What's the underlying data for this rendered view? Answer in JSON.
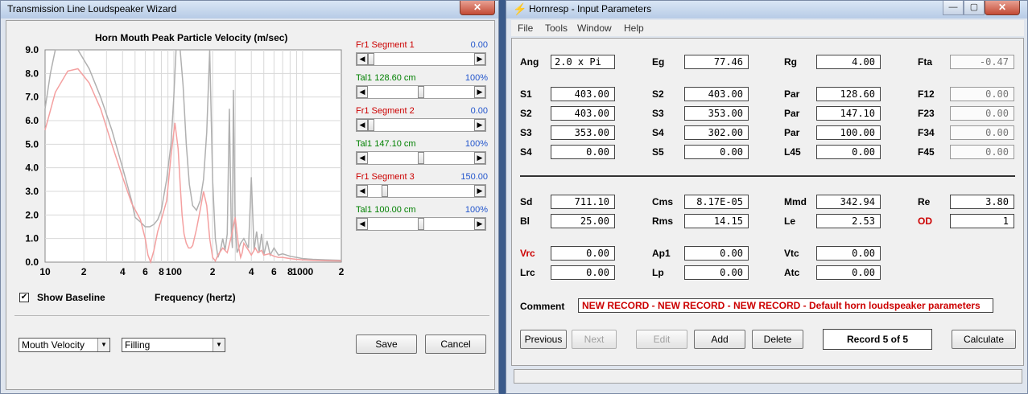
{
  "wizard": {
    "title": "Transmission Line Loudspeaker Wizard",
    "close_glyph": "✕",
    "chart_title": "Horn Mouth Peak Particle Velocity (m/sec)",
    "show_baseline_label": "Show Baseline",
    "show_baseline_checked": true,
    "check_glyph": "✔",
    "freq_label": "Frequency (hertz)",
    "dropdown_left": "Mouth Velocity",
    "dropdown_right": "Filling",
    "dd_glyph": "▼",
    "save_label": "Save",
    "cancel_label": "Cancel",
    "sliders": [
      {
        "label": "Fr1  Segment 1",
        "value": "0.00",
        "pos": 0.0,
        "color": "red"
      },
      {
        "label": "Tal1  128.60 cm",
        "value": "100%",
        "pos": 0.5,
        "color": "green"
      },
      {
        "label": "Fr1  Segment 2",
        "value": "0.00",
        "pos": 0.0,
        "color": "red"
      },
      {
        "label": "Tal1  147.10 cm",
        "value": "100%",
        "pos": 0.5,
        "color": "green"
      },
      {
        "label": "Fr1  Segment 3",
        "value": "150.00",
        "pos": 0.14,
        "color": "red"
      },
      {
        "label": "Tal1  100.00 cm",
        "value": "100%",
        "pos": 0.5,
        "color": "green"
      }
    ],
    "arrow_left": "◀",
    "arrow_right": "▶"
  },
  "hornresp": {
    "title": "Hornresp - Input Parameters",
    "minimize_glyph": "—",
    "maximize_glyph": "▢",
    "close_glyph": "✕",
    "menu": [
      "File",
      "Tools",
      "Window",
      "Help"
    ],
    "rows": [
      [
        {
          "label": "Ang",
          "value": "2.0 x Pi",
          "left": true
        },
        {
          "label": "Eg",
          "value": "77.46"
        },
        {
          "label": "Rg",
          "value": "4.00"
        },
        {
          "label": "Fta",
          "value": "-0.47",
          "ro": true
        }
      ],
      [
        {
          "label": "S1",
          "value": "403.00"
        },
        {
          "label": "S2",
          "value": "403.00"
        },
        {
          "label": "Par",
          "value": "128.60"
        },
        {
          "label": "F12",
          "value": "0.00",
          "ro": true
        }
      ],
      [
        {
          "label": "S2",
          "value": "403.00"
        },
        {
          "label": "S3",
          "value": "353.00"
        },
        {
          "label": "Par",
          "value": "147.10"
        },
        {
          "label": "F23",
          "value": "0.00",
          "ro": true
        }
      ],
      [
        {
          "label": "S3",
          "value": "353.00"
        },
        {
          "label": "S4",
          "value": "302.00"
        },
        {
          "label": "Par",
          "value": "100.00"
        },
        {
          "label": "F34",
          "value": "0.00",
          "ro": true
        }
      ],
      [
        {
          "label": "S4",
          "value": "0.00"
        },
        {
          "label": "S5",
          "value": "0.00"
        },
        {
          "label": "L45",
          "value": "0.00"
        },
        {
          "label": "F45",
          "value": "0.00",
          "ro": true
        }
      ],
      [
        {
          "label": "Sd",
          "value": "711.10"
        },
        {
          "label": "Cms",
          "value": "8.17E-05"
        },
        {
          "label": "Mmd",
          "value": "342.94"
        },
        {
          "label": "Re",
          "value": "3.80"
        }
      ],
      [
        {
          "label": "Bl",
          "value": "25.00"
        },
        {
          "label": "Rms",
          "value": "14.15"
        },
        {
          "label": "Le",
          "value": "2.53"
        },
        {
          "label": "OD",
          "value": "1",
          "red": true
        }
      ],
      [
        {
          "label": "Vrc",
          "value": "0.00",
          "red": true
        },
        {
          "label": "Ap1",
          "value": "0.00"
        },
        {
          "label": "Vtc",
          "value": "0.00"
        }
      ],
      [
        {
          "label": "Lrc",
          "value": "0.00"
        },
        {
          "label": "Lp",
          "value": "0.00"
        },
        {
          "label": "Atc",
          "value": "0.00"
        }
      ]
    ],
    "comment_label": "Comment",
    "comment_value": "NEW RECORD - NEW RECORD - NEW RECORD - Default horn loudspeaker parameters",
    "buttons": {
      "previous": "Previous",
      "next": "Next",
      "edit": "Edit",
      "add": "Add",
      "delete": "Delete",
      "record": "Record 5 of 5",
      "calculate": "Calculate"
    }
  },
  "chart_data": {
    "type": "line",
    "title": "Horn Mouth Peak Particle Velocity (m/sec)",
    "xlabel": "Frequency (hertz)",
    "ylabel": "",
    "x_scale": "log",
    "xlim": [
      10,
      2000
    ],
    "ylim": [
      0,
      9
    ],
    "y_ticks": [
      "0.0",
      "1.0",
      "2.0",
      "3.0",
      "4.0",
      "5.0",
      "6.0",
      "7.0",
      "8.0",
      "9.0"
    ],
    "x_ticks": [
      {
        "v": 10,
        "label": "10"
      },
      {
        "v": 20,
        "label": "2"
      },
      {
        "v": 40,
        "label": "4"
      },
      {
        "v": 60,
        "label": "6"
      },
      {
        "v": 80,
        "label": "8"
      },
      {
        "v": 100,
        "label": "100"
      },
      {
        "v": 200,
        "label": "2"
      },
      {
        "v": 400,
        "label": "4"
      },
      {
        "v": 600,
        "label": "6"
      },
      {
        "v": 800,
        "label": "8"
      },
      {
        "v": 1000,
        "label": "1000"
      },
      {
        "v": 2000,
        "label": "2"
      }
    ],
    "grid": true,
    "series": [
      {
        "color": "#f4a0a0",
        "x": [
          10,
          12,
          15,
          18,
          22,
          27,
          33,
          40,
          47,
          55,
          60,
          63,
          66,
          70,
          75,
          80,
          88,
          95,
          102,
          108,
          112,
          116,
          120,
          125,
          130,
          135,
          140,
          150,
          160,
          170,
          180,
          190,
          200,
          210,
          220,
          240,
          260,
          280,
          300,
          310,
          320,
          330,
          340,
          350,
          380,
          400,
          430,
          450,
          480,
          500,
          550,
          600,
          650,
          700,
          800,
          900,
          1000,
          1200,
          1500,
          2000
        ],
        "y": [
          5.6,
          7.2,
          8.1,
          8.2,
          7.6,
          6.5,
          5.0,
          3.6,
          2.5,
          1.8,
          1.0,
          0.3,
          0.0,
          0.5,
          1.3,
          1.8,
          2.6,
          4.5,
          5.9,
          4.8,
          3.3,
          2.0,
          1.2,
          0.8,
          0.6,
          0.6,
          0.7,
          1.4,
          2.2,
          3.0,
          2.4,
          1.0,
          0.2,
          0.05,
          0.3,
          0.6,
          0.4,
          1.1,
          1.9,
          1.2,
          0.6,
          0.2,
          0.4,
          0.8,
          0.5,
          0.3,
          0.6,
          0.4,
          0.5,
          0.3,
          0.35,
          0.25,
          0.2,
          0.2,
          0.15,
          0.12,
          0.1,
          0.08,
          0.06,
          0.05
        ]
      },
      {
        "color": "#b0b0b0",
        "x": [
          10,
          11,
          12,
          13,
          14,
          14.5,
          15,
          16,
          18,
          22,
          27,
          33,
          40,
          47,
          50,
          55,
          60,
          65,
          70,
          75,
          80,
          88,
          95,
          100,
          104,
          108,
          112,
          118,
          125,
          132,
          140,
          150,
          160,
          170,
          180,
          190,
          200,
          210,
          220,
          230,
          240,
          250,
          260,
          270,
          280,
          285,
          290,
          300,
          310,
          330,
          350,
          380,
          400,
          420,
          440,
          460,
          480,
          500,
          530,
          560,
          600,
          650,
          700,
          800,
          900,
          1000,
          1200,
          1500,
          2000
        ],
        "y": [
          6.5,
          8.0,
          9.0,
          9.0,
          9.0,
          9.0,
          9.0,
          9.0,
          9.0,
          8.2,
          7.0,
          5.6,
          4.0,
          2.6,
          1.9,
          1.7,
          1.5,
          1.5,
          1.6,
          1.8,
          2.2,
          3.5,
          5.0,
          7.0,
          9.0,
          9.0,
          9.0,
          7.5,
          5.0,
          3.3,
          2.4,
          2.2,
          2.6,
          3.5,
          5.5,
          9.0,
          3.5,
          1.0,
          0.2,
          0.5,
          1.0,
          0.5,
          1.2,
          6.5,
          1.2,
          0.6,
          7.3,
          1.5,
          0.4,
          0.8,
          1.0,
          0.6,
          3.6,
          0.5,
          1.3,
          0.4,
          1.2,
          0.3,
          0.9,
          0.3,
          0.6,
          0.3,
          0.35,
          0.25,
          0.2,
          0.15,
          0.12,
          0.1,
          0.08
        ]
      }
    ]
  }
}
